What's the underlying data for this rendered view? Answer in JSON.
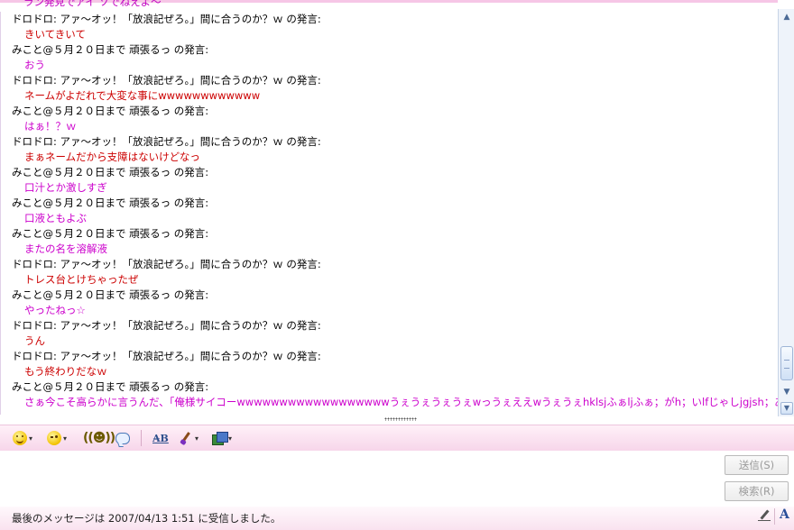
{
  "chat": {
    "top_partial": "ラン発見でアイ ソでねえよ〜",
    "lines": [
      {
        "text": "ドロドロ: アァ〜オッ！「放浪記ぜろ。」間に合うのか？ｗ の発言:",
        "kind": "name"
      },
      {
        "text": "きいてきいて",
        "kind": "red"
      },
      {
        "text": "みこと@５月２０日まで 頑張るっ の発言:",
        "kind": "name"
      },
      {
        "text": "おう",
        "kind": "mag"
      },
      {
        "text": "ドロドロ: アァ〜オッ！「放浪記ぜろ。」間に合うのか？ｗ の発言:",
        "kind": "name"
      },
      {
        "text": "ネームがよだれで大変な事にwwwwwwwwwwww",
        "kind": "red"
      },
      {
        "text": "みこと@５月２０日まで 頑張るっ の発言:",
        "kind": "name"
      },
      {
        "text": "はぁ！？ｗ",
        "kind": "mag"
      },
      {
        "text": "ドロドロ: アァ〜オッ！「放浪記ぜろ。」間に合うのか？ｗ の発言:",
        "kind": "name"
      },
      {
        "text": "まぁネームだから支障はないけどなっ",
        "kind": "red"
      },
      {
        "text": "みこと@５月２０日まで 頑張るっ の発言:",
        "kind": "name"
      },
      {
        "text": "口汁とか激しすぎ",
        "kind": "mag"
      },
      {
        "text": "みこと@５月２０日まで 頑張るっ の発言:",
        "kind": "name"
      },
      {
        "text": "口液ともよぶ",
        "kind": "mag"
      },
      {
        "text": "みこと@５月２０日まで 頑張るっ の発言:",
        "kind": "name"
      },
      {
        "text": "またの名を溶解液",
        "kind": "mag"
      },
      {
        "text": "ドロドロ: アァ〜オッ！「放浪記ぜろ。」間に合うのか？ｗ の発言:",
        "kind": "name"
      },
      {
        "text": "トレス台とけちゃったぜ",
        "kind": "red"
      },
      {
        "text": "みこと@５月２０日まで 頑張るっ の発言:",
        "kind": "name"
      },
      {
        "text": "やったねっ☆",
        "kind": "mag"
      },
      {
        "text": "ドロドロ: アァ〜オッ！「放浪記ぜろ。」間に合うのか？ｗ の発言:",
        "kind": "name"
      },
      {
        "text": "うん",
        "kind": "red"
      },
      {
        "text": "ドロドロ: アァ〜オッ！「放浪記ぜろ。」間に合うのか？ｗ の発言:",
        "kind": "name"
      },
      {
        "text": "もう終わりだなｗ",
        "kind": "red"
      },
      {
        "text": "みこと@５月２０日まで 頑張るっ の発言:",
        "kind": "name"
      },
      {
        "text": "さぁ今こそ高らかに言うんだ、「俺様サイコーwwwwwwwwwwwwwwwwwwうぇうぇうぇうぇwっうぇええwうぇうぇhklsjふぁljふぁ；がh；いlfじゃしjgjsh；あおlhぁh」ってな",
        "kind": "mag"
      }
    ]
  },
  "toolbar": {
    "items": [
      "emoticon",
      "wink",
      "nudge",
      "message-bubble",
      "font",
      "background-brush",
      "background-image"
    ]
  },
  "input": {
    "value": ""
  },
  "buttons": {
    "send": "送信(S)",
    "search": "検索(R)"
  },
  "status": {
    "text": "最後のメッセージは 2007/04/13 1:51 に受信しました。"
  },
  "colors": {
    "name": "#000000",
    "red": "#cc0000",
    "magenta": "#cc00cc",
    "toolbar_bg": "#f7d6ea"
  }
}
